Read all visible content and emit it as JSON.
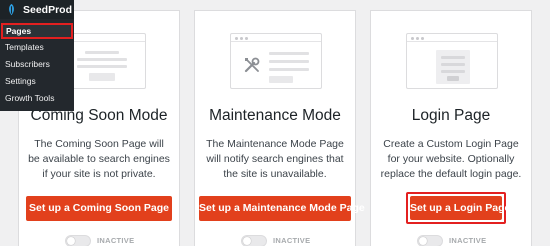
{
  "admin_menu": {
    "brand": "SeedProd",
    "items": [
      {
        "label": "Pages",
        "active": true
      },
      {
        "label": "Templates",
        "active": false
      },
      {
        "label": "Subscribers",
        "active": false
      },
      {
        "label": "Settings",
        "active": false
      },
      {
        "label": "Growth Tools",
        "active": false
      }
    ]
  },
  "cards": [
    {
      "title": "Coming Soon Mode",
      "description": "The Coming Soon Page will be available to search engines if your site is not private.",
      "button": "Set up a Coming Soon Page",
      "status": "INACTIVE",
      "icon": "browser-illustration-icon"
    },
    {
      "title": "Maintenance Mode",
      "description": "The Maintenance Mode Page will notify search engines that the site is unavailable.",
      "button": "Set up a Maintenance Mode Page",
      "status": "INACTIVE",
      "icon": "tools-illustration-icon"
    },
    {
      "title": "Login Page",
      "description": "Create a Custom Login Page for your website. Optionally replace the default login page.",
      "button": "Set up a Login Page",
      "status": "INACTIVE",
      "icon": "login-illustration-icon"
    }
  ],
  "colors": {
    "accent": "#e2401c",
    "highlight": "#e32020",
    "admin_bg": "#23282d",
    "card_bg": "#ffffff",
    "page_bg": "#f0f0f1"
  }
}
